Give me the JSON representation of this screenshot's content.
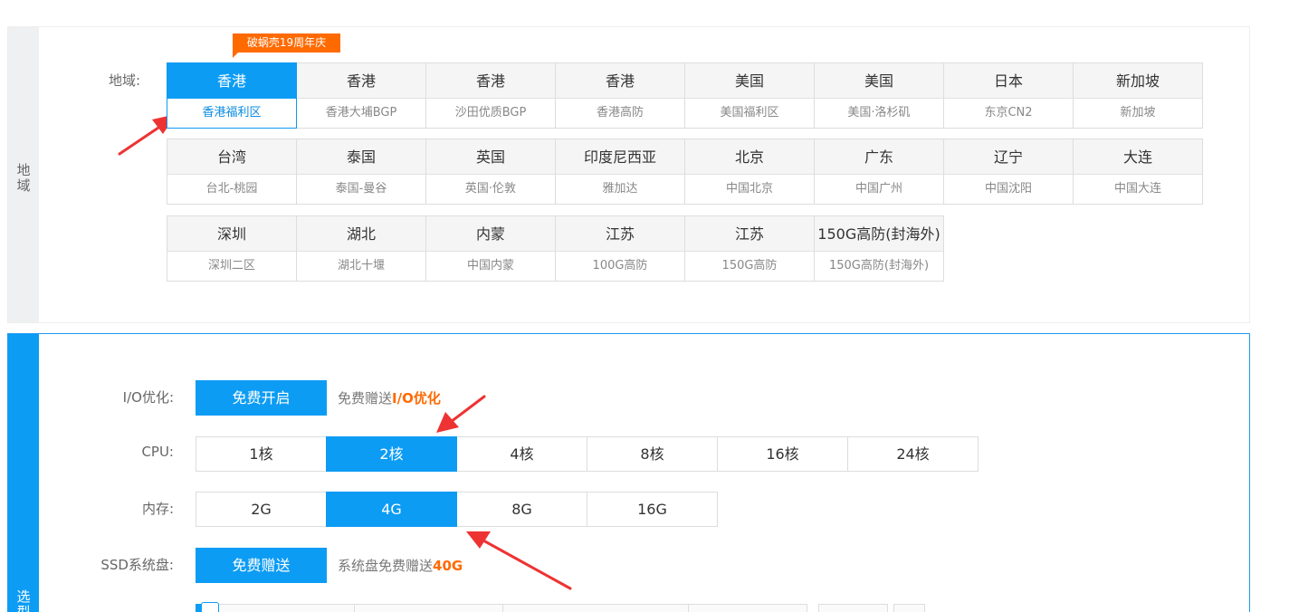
{
  "region_section": {
    "side_label": "地域",
    "field_label": "地域:",
    "promo_badge": "破蜗壳19周年庆",
    "rows": [
      [
        {
          "name": "香港",
          "sub": "香港福利区",
          "selected": true
        },
        {
          "name": "香港",
          "sub": "香港大埔BGP"
        },
        {
          "name": "香港",
          "sub": "沙田优质BGP"
        },
        {
          "name": "香港",
          "sub": "香港高防"
        },
        {
          "name": "美国",
          "sub": "美国福利区"
        },
        {
          "name": "美国",
          "sub": "美国·洛杉矶"
        },
        {
          "name": "日本",
          "sub": "东京CN2"
        },
        {
          "name": "新加坡",
          "sub": "新加坡"
        }
      ],
      [
        {
          "name": "台湾",
          "sub": "台北-桃园"
        },
        {
          "name": "泰国",
          "sub": "泰国-曼谷"
        },
        {
          "name": "英国",
          "sub": "英国·伦敦"
        },
        {
          "name": "印度尼西亚",
          "sub": "雅加达"
        },
        {
          "name": "北京",
          "sub": "中国北京"
        },
        {
          "name": "广东",
          "sub": "中国广州"
        },
        {
          "name": "辽宁",
          "sub": "中国沈阳"
        },
        {
          "name": "大连",
          "sub": "中国大连"
        }
      ],
      [
        {
          "name": "深圳",
          "sub": "深圳二区"
        },
        {
          "name": "湖北",
          "sub": "湖北十堰"
        },
        {
          "name": "内蒙",
          "sub": "中国内蒙"
        },
        {
          "name": "江苏",
          "sub": "100G高防"
        },
        {
          "name": "江苏",
          "sub": "150G高防"
        },
        {
          "name": "150G高防(封海外)",
          "sub": "150G高防(封海外)"
        }
      ]
    ]
  },
  "config_section": {
    "side_label": "选型",
    "io": {
      "label": "I/O优化:",
      "button": "免费开启",
      "note_prefix": "免费赠送",
      "note_highlight": "I/O优化"
    },
    "cpu": {
      "label": "CPU:",
      "options": [
        "1核",
        "2核",
        "4核",
        "8核",
        "16核",
        "24核"
      ],
      "selected": 1
    },
    "memory": {
      "label": "内存:",
      "options": [
        "2G",
        "4G",
        "8G",
        "16G"
      ],
      "selected": 1
    },
    "ssd": {
      "label": "SSD系统盘:",
      "button": "免费赠送",
      "note_prefix": "系统盘免费赠送",
      "note_highlight": "40G"
    }
  },
  "colors": {
    "accent": "#0d9cf4",
    "highlight": "#ff6a00",
    "arrow": "#ee3333"
  },
  "icons": {
    "arrow": "red-arrow-icon"
  }
}
